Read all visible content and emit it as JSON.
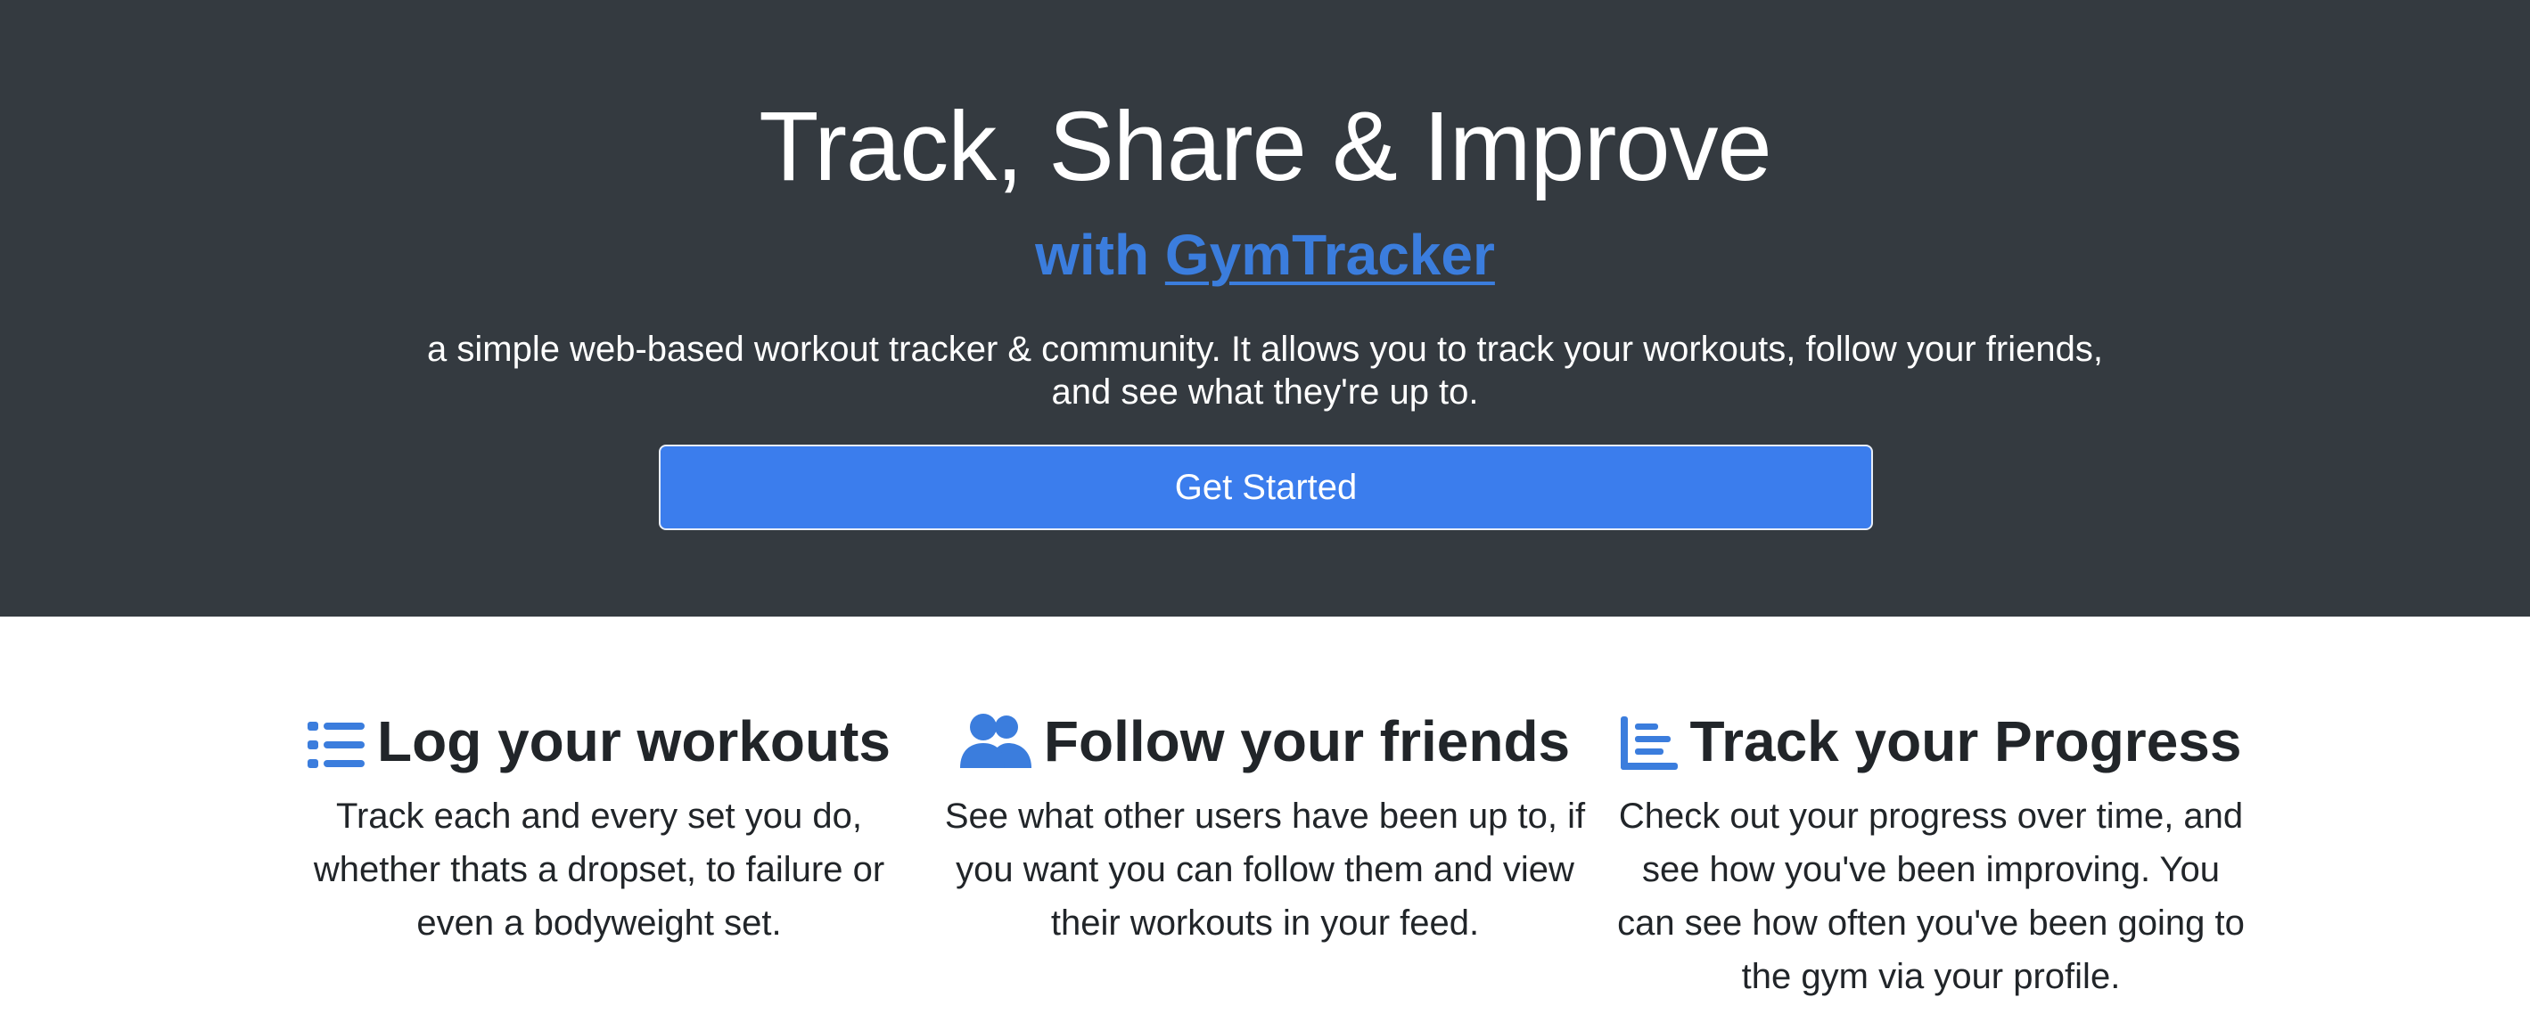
{
  "hero": {
    "title": "Track, Share & Improve",
    "subtitle_prefix": "with ",
    "subtitle_link": "GymTracker",
    "lead": "a simple web-based workout tracker & community. It allows you to track your workouts, follow your friends, and see what they're up to.",
    "cta_label": "Get Started"
  },
  "features": [
    {
      "icon": "list-icon",
      "title": "Log your workouts",
      "text": "Track each and every set you do, whether thats a dropset, to failure or even a bodyweight set."
    },
    {
      "icon": "users-icon",
      "title": "Follow your friends",
      "text": "See what other users have been up to, if you want you can follow them and view their workouts in your feed."
    },
    {
      "icon": "bar-chart-icon",
      "title": "Track your Progress",
      "text": "Check out your progress over time, and see how you've been improving. You can see how often you've been going to the gym via your profile."
    }
  ],
  "colors": {
    "hero_background": "#343a40",
    "accent": "#3b7ddd",
    "button": "#3b7ded",
    "text": "#212529"
  }
}
